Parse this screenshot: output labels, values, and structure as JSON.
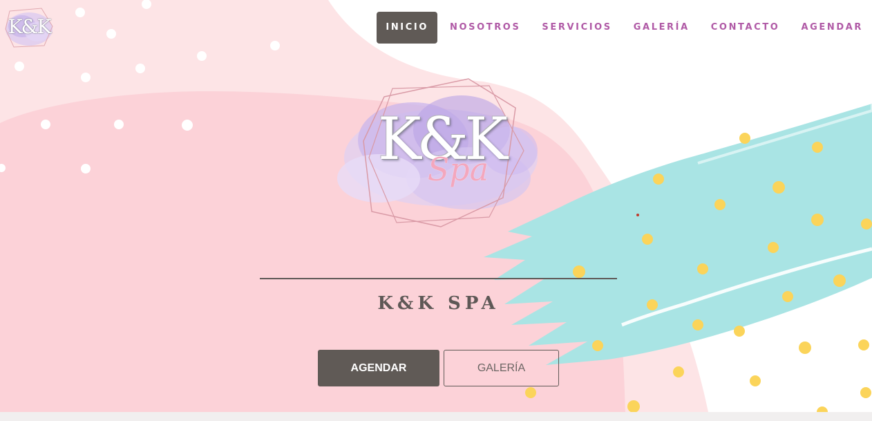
{
  "brand": {
    "corner_logo_text": "K&K",
    "logo_main": "K&K",
    "logo_script": "Spa"
  },
  "nav": {
    "items": [
      {
        "label": "INICIO",
        "active": true
      },
      {
        "label": "NOSOTROS",
        "active": false
      },
      {
        "label": "SERVICIOS",
        "active": false
      },
      {
        "label": "GALERÍA",
        "active": false
      },
      {
        "label": "CONTACTO",
        "active": false
      },
      {
        "label": "AGENDAR",
        "active": false
      }
    ]
  },
  "hero": {
    "title": "K&K SPA",
    "primary_button": "AGENDAR",
    "secondary_button": "GALERÍA"
  },
  "icons": [
    "corner-logo-icon",
    "main-logo-icon"
  ],
  "colors": {
    "nav_text": "#b05aa6",
    "dark": "#605a56",
    "pink_light": "#fde4e6",
    "pink": "#fcd2d8",
    "teal": "#a9e4e4",
    "yellow_dots": "#fbd45a"
  }
}
